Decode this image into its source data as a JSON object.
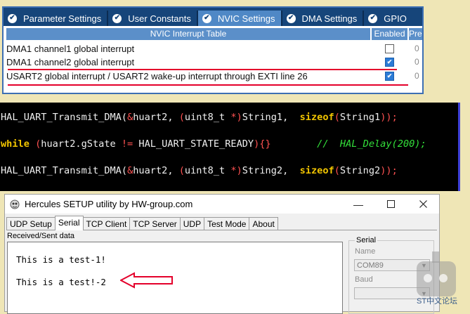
{
  "cubemx": {
    "tabs": [
      "Parameter Settings",
      "User Constants",
      "NVIC Settings",
      "DMA Settings",
      "GPIO"
    ],
    "active_tab": "NVIC Settings",
    "table_title": "NVIC Interrupt Table",
    "col_enabled": "Enabled",
    "col_preemption": "Pree",
    "rows": [
      {
        "name": "DMA1 channel1 global interrupt",
        "enabled": false,
        "priority": "0"
      },
      {
        "name": "DMA1 channel2 global interrupt",
        "enabled": true,
        "priority": "0"
      },
      {
        "name": "USART2 global interrupt / USART2 wake-up interrupt through EXTI line 26",
        "enabled": true,
        "priority": "0"
      }
    ],
    "highlight_color": "#e4002b"
  },
  "code": {
    "line1": {
      "a": "HAL_UART_Transmit_DMA(",
      "b": "&",
      "c": "huart2, ",
      "d": "(",
      "e": "uint8_t ",
      "f": "*)",
      "g": "String1,  ",
      "h": "sizeof",
      "i": "(",
      "j": "String1",
      "k": "));"
    },
    "line2": {
      "a": "while",
      "b": " (",
      "c": "huart2.gState ",
      "d": "!=",
      "e": " HAL_UART_STATE_READY",
      "f": "){}",
      "g": "        //  HAL_Delay(200);"
    },
    "line3": {
      "a": "HAL_UART_Transmit_DMA(",
      "b": "&",
      "c": "huart2, ",
      "d": "(",
      "e": "uint8_t ",
      "f": "*)",
      "g": "String2,  ",
      "h": "sizeof",
      "i": "(",
      "j": "String2",
      "k": "));"
    }
  },
  "hercules": {
    "title": "Hercules SETUP utility by HW-group.com",
    "tabs": [
      "UDP Setup",
      "Serial",
      "TCP Client",
      "TCP Server",
      "UDP",
      "Test Mode",
      "About"
    ],
    "active_tab": "Serial",
    "received_label": "Received/Sent data",
    "received_lines": [
      "This is a test-1!",
      "This is a test!-2"
    ],
    "serial_group": {
      "title": "Serial",
      "name_label": "Name",
      "port": "COM89",
      "baud_label": "Baud"
    },
    "arrow_color": "#e4002b"
  },
  "watermark": {
    "text": "ST中文论坛"
  }
}
